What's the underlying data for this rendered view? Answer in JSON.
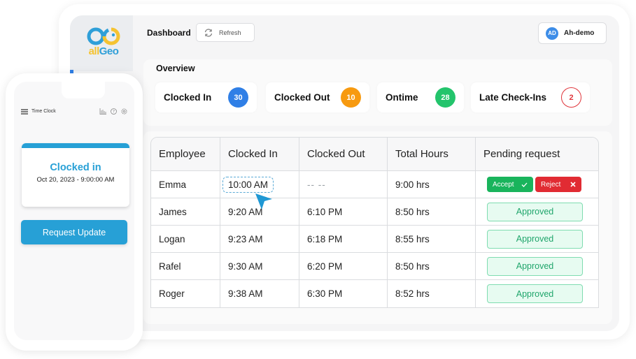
{
  "brand": {
    "logo_part1": "all",
    "logo_part2": "Geo",
    "colors": {
      "blue": "#2f9fd8",
      "yellow": "#f5c332"
    }
  },
  "topbar": {
    "title": "Dashboard",
    "refresh_label": "Refresh",
    "refresh_icon": "refresh-icon",
    "user_initials": "AD",
    "user_name": "Ah-demo"
  },
  "overview": {
    "title": "Overview",
    "stats": [
      {
        "label": "Clocked In",
        "value": "30",
        "color": "#2f7fe6",
        "style": "filled"
      },
      {
        "label": "Clocked Out",
        "value": "10",
        "color": "#f79a10",
        "style": "filled"
      },
      {
        "label": "Ontime",
        "value": "28",
        "color": "#23c46c",
        "style": "filled"
      },
      {
        "label": "Late Check-Ins",
        "value": "2",
        "color": "#e0353b",
        "style": "outline"
      }
    ]
  },
  "table": {
    "columns": [
      "Employee",
      "Clocked In",
      "Clocked Out",
      "Total Hours",
      "Pending request"
    ],
    "rows": [
      {
        "employee": "Emma",
        "clocked_in": "10:00 AM",
        "clocked_out": "-- --",
        "total_hours": "9:00 hrs",
        "status": "pending",
        "editing": true
      },
      {
        "employee": "James",
        "clocked_in": "9:20 AM",
        "clocked_out": "6:10 PM",
        "total_hours": "8:50 hrs",
        "status": "Approved"
      },
      {
        "employee": "Logan",
        "clocked_in": "9:23 AM",
        "clocked_out": "6:18 PM",
        "total_hours": "8:55 hrs",
        "status": "Approved"
      },
      {
        "employee": "Rafel",
        "clocked_in": "9:30 AM",
        "clocked_out": "6:20 PM",
        "total_hours": "8:50 hrs",
        "status": "Approved"
      },
      {
        "employee": "Roger",
        "clocked_in": "9:38 AM",
        "clocked_out": "6:30 PM",
        "total_hours": "8:52 hrs",
        "status": "Approved"
      }
    ],
    "accept_label": "Accept",
    "accept_icon": "check-icon",
    "reject_label": "Reject",
    "reject_icon": "close-icon"
  },
  "phone": {
    "header_title": "Time Clock",
    "header_icons": [
      "menu-icon",
      "chart-icon",
      "help-icon",
      "settings-icon"
    ],
    "status_title": "Clocked in",
    "status_time": "Oct 20, 2023 - 9:00:00 AM",
    "request_button": "Request Update"
  }
}
